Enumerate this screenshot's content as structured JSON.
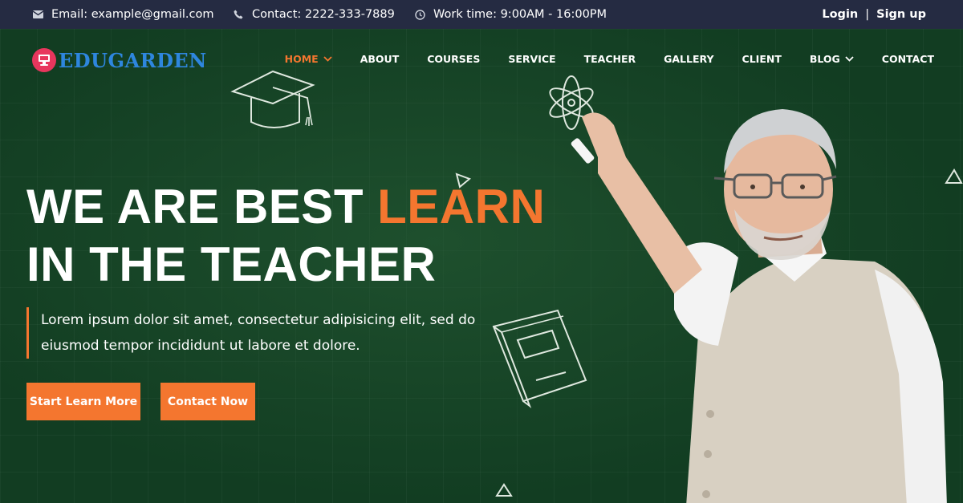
{
  "topbar": {
    "email": "Email: example@gmail.com",
    "contact": "Contact: 2222-333-7889",
    "work_time": "Work time: 9:00AM - 16:00PM",
    "login": "Login",
    "separator": "|",
    "signup": "Sign up"
  },
  "logo": {
    "text": "EDUGARDEN",
    "badge_color": "#e8365d",
    "text_color": "#2e86de"
  },
  "nav": {
    "items": [
      {
        "label": "HOME",
        "active": true,
        "dropdown": true
      },
      {
        "label": "ABOUT"
      },
      {
        "label": "COURSES"
      },
      {
        "label": "SERVICE"
      },
      {
        "label": "TEACHER"
      },
      {
        "label": "GALLERY"
      },
      {
        "label": "CLIENT"
      },
      {
        "label": "BLOG",
        "dropdown": true
      },
      {
        "label": "CONTACT"
      }
    ]
  },
  "hero": {
    "headline_part1": "WE ARE BEST ",
    "headline_accent": "LEARN",
    "headline_line2": "IN THE TEACHER",
    "description_line1": "Lorem ipsum dolor sit amet, consectetur adipisicing elit, sed do",
    "description_line2": "eiusmod tempor incididunt ut labore et dolore.",
    "primary_button": "Start Learn More",
    "secondary_button": "Contact Now"
  },
  "colors": {
    "accent": "#f4762f",
    "topbar_bg": "#252b42",
    "hero_bg": "#123d22"
  },
  "icons": [
    "envelope-icon",
    "phone-icon",
    "clock-icon",
    "chevron-down-icon",
    "graduation-cap-doodle",
    "atom-doodle",
    "book-doodle",
    "triangle-doodle"
  ]
}
